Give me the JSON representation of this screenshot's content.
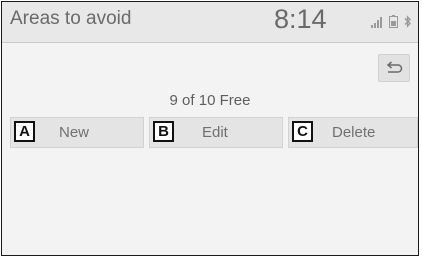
{
  "header": {
    "title": "Areas to avoid",
    "clock": "8:14",
    "status_icons": [
      "signal-icon",
      "battery-icon",
      "bluetooth-icon"
    ]
  },
  "back_button": {
    "icon": "return-arrow-icon"
  },
  "free_status": "9 of 10 Free",
  "buttons": [
    {
      "badge": "A",
      "label": "New"
    },
    {
      "badge": "B",
      "label": "Edit"
    },
    {
      "badge": "C",
      "label": "Delete"
    }
  ],
  "colors": {
    "background": "#f3f3f3",
    "header": "#e8e8e8",
    "button": "#e4e4e4",
    "text": "#6a6a6a",
    "badge_border": "#111111"
  }
}
